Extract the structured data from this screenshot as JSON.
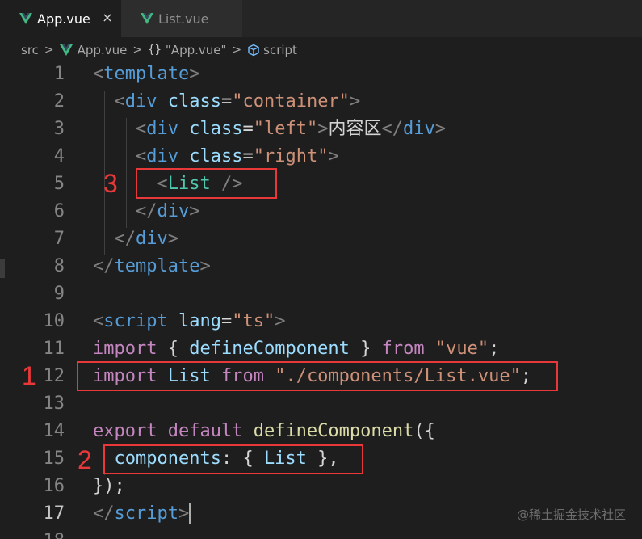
{
  "tabs": [
    {
      "label": "App.vue",
      "active": true,
      "close": "×"
    },
    {
      "label": "List.vue",
      "active": false
    }
  ],
  "breadcrumb": {
    "items": [
      "src",
      "App.vue",
      "\"App.vue\"",
      "script"
    ],
    "separator": ">",
    "braces": "{}"
  },
  "colors": {
    "background": "#1e1e1e",
    "tag": "#569cd6",
    "attribute": "#9cdcfe",
    "string": "#ce9178",
    "component": "#4ec9b0",
    "keyword": "#c586c0",
    "function": "#dcdcaa",
    "annotation": "#e8383a"
  },
  "code": {
    "line_numbers": [
      "1",
      "2",
      "3",
      "4",
      "5",
      "6",
      "7",
      "8",
      "9",
      "10",
      "11",
      "12",
      "13",
      "14",
      "15",
      "16",
      "17",
      "18"
    ],
    "current_line": "17",
    "lines": [
      [
        [
          "t-bracket",
          "<"
        ],
        [
          "t-tag",
          "template"
        ],
        [
          "t-bracket",
          ">"
        ]
      ],
      [
        [
          "t-plain",
          "  "
        ],
        [
          "t-bracket",
          "<"
        ],
        [
          "t-tag",
          "div"
        ],
        [
          "t-plain",
          " "
        ],
        [
          "t-attr",
          "class"
        ],
        [
          "t-plain",
          "="
        ],
        [
          "t-str",
          "\"container\""
        ],
        [
          "t-bracket",
          ">"
        ]
      ],
      [
        [
          "t-plain",
          "    "
        ],
        [
          "t-bracket",
          "<"
        ],
        [
          "t-tag",
          "div"
        ],
        [
          "t-plain",
          " "
        ],
        [
          "t-attr",
          "class"
        ],
        [
          "t-plain",
          "="
        ],
        [
          "t-str",
          "\"left\""
        ],
        [
          "t-bracket",
          ">"
        ],
        [
          "t-text",
          "内容区"
        ],
        [
          "t-bracket",
          "</"
        ],
        [
          "t-tag",
          "div"
        ],
        [
          "t-bracket",
          ">"
        ]
      ],
      [
        [
          "t-plain",
          "    "
        ],
        [
          "t-bracket",
          "<"
        ],
        [
          "t-tag",
          "div"
        ],
        [
          "t-plain",
          " "
        ],
        [
          "t-attr",
          "class"
        ],
        [
          "t-plain",
          "="
        ],
        [
          "t-str",
          "\"right\""
        ],
        [
          "t-bracket",
          ">"
        ]
      ],
      [
        [
          "t-plain",
          "      "
        ],
        [
          "t-bracket",
          "<"
        ],
        [
          "t-comp",
          "List"
        ],
        [
          "t-plain",
          " "
        ],
        [
          "t-bracket",
          "/>"
        ]
      ],
      [
        [
          "t-plain",
          "    "
        ],
        [
          "t-bracket",
          "</"
        ],
        [
          "t-tag",
          "div"
        ],
        [
          "t-bracket",
          ">"
        ]
      ],
      [
        [
          "t-plain",
          "  "
        ],
        [
          "t-bracket",
          "</"
        ],
        [
          "t-tag",
          "div"
        ],
        [
          "t-bracket",
          ">"
        ]
      ],
      [
        [
          "t-bracket",
          "</"
        ],
        [
          "t-tag",
          "template"
        ],
        [
          "t-bracket",
          ">"
        ]
      ],
      [],
      [
        [
          "t-bracket",
          "<"
        ],
        [
          "t-tag",
          "script"
        ],
        [
          "t-plain",
          " "
        ],
        [
          "t-attr",
          "lang"
        ],
        [
          "t-plain",
          "="
        ],
        [
          "t-str",
          "\"ts\""
        ],
        [
          "t-bracket",
          ">"
        ]
      ],
      [
        [
          "t-kw",
          "import"
        ],
        [
          "t-plain",
          " { "
        ],
        [
          "t-var",
          "defineComponent"
        ],
        [
          "t-plain",
          " } "
        ],
        [
          "t-kw",
          "from"
        ],
        [
          "t-plain",
          " "
        ],
        [
          "t-str",
          "\"vue\""
        ],
        [
          "t-plain",
          ";"
        ]
      ],
      [
        [
          "t-kw",
          "import"
        ],
        [
          "t-plain",
          " "
        ],
        [
          "t-var",
          "List"
        ],
        [
          "t-plain",
          " "
        ],
        [
          "t-kw",
          "from"
        ],
        [
          "t-plain",
          " "
        ],
        [
          "t-str",
          "\"./components/List.vue\""
        ],
        [
          "t-plain",
          ";"
        ]
      ],
      [],
      [
        [
          "t-kw",
          "export"
        ],
        [
          "t-plain",
          " "
        ],
        [
          "t-kw",
          "default"
        ],
        [
          "t-plain",
          " "
        ],
        [
          "t-fn",
          "defineComponent"
        ],
        [
          "t-plain",
          "({"
        ]
      ],
      [
        [
          "t-plain",
          "  "
        ],
        [
          "t-var",
          "components"
        ],
        [
          "t-plain",
          ": { "
        ],
        [
          "t-var",
          "List"
        ],
        [
          "t-plain",
          " },"
        ]
      ],
      [
        [
          "t-plain",
          "});"
        ]
      ],
      [
        [
          "t-bracket",
          "</"
        ],
        [
          "t-tag",
          "script"
        ],
        [
          "t-bracket",
          ">"
        ]
      ],
      []
    ]
  },
  "annotations": [
    {
      "label": "1",
      "line": "12"
    },
    {
      "label": "2",
      "line": "15"
    },
    {
      "label": "3",
      "line": "5"
    }
  ],
  "watermark": "@稀土掘金技术社区"
}
